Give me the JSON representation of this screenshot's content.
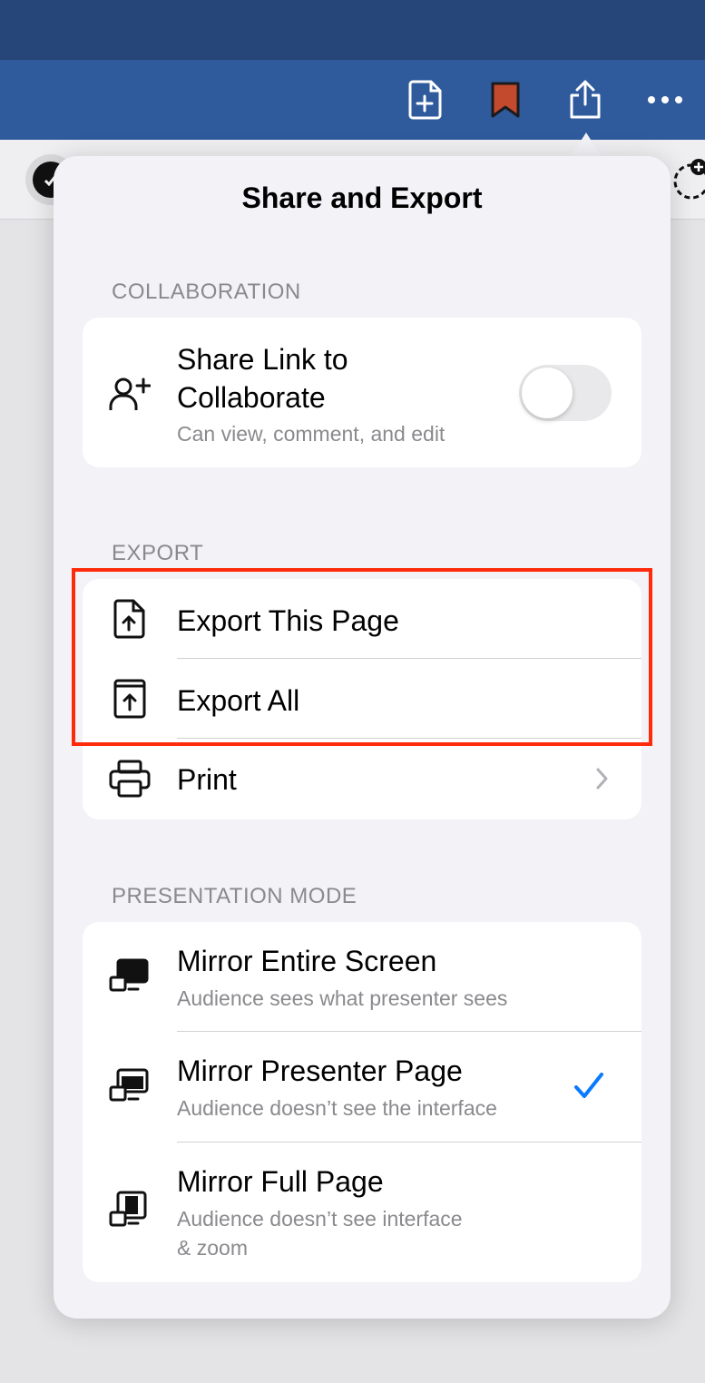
{
  "toolbar": {
    "icons": [
      "add-page-icon",
      "bookmark-icon",
      "share-icon",
      "more-icon"
    ],
    "bookmark_color": "#c44a2e"
  },
  "popover": {
    "title": "Share and Export",
    "collaboration": {
      "header": "COLLABORATION",
      "share_link": {
        "title_line1": "Share Link to",
        "title_line2": "Collaborate",
        "subtitle": "Can view, comment, and edit",
        "enabled": false
      }
    },
    "export": {
      "header": "EXPORT",
      "items": [
        {
          "label": "Export This Page"
        },
        {
          "label": "Export All"
        },
        {
          "label": "Print"
        }
      ]
    },
    "presentation": {
      "header": "PRESENTATION MODE",
      "items": [
        {
          "title": "Mirror Entire Screen",
          "subtitle": "Audience sees what presenter sees",
          "selected": false
        },
        {
          "title": "Mirror Presenter Page",
          "subtitle": "Audience doesn’t see the interface",
          "selected": true
        },
        {
          "title": "Mirror Full Page",
          "subtitle_line1": "Audience doesn’t see interface",
          "subtitle_line2": "& zoom",
          "selected": false
        }
      ]
    }
  },
  "colors": {
    "accent": "#0a7aff",
    "highlight": "#ff2a0c",
    "topbar": "#2f5a9c"
  }
}
